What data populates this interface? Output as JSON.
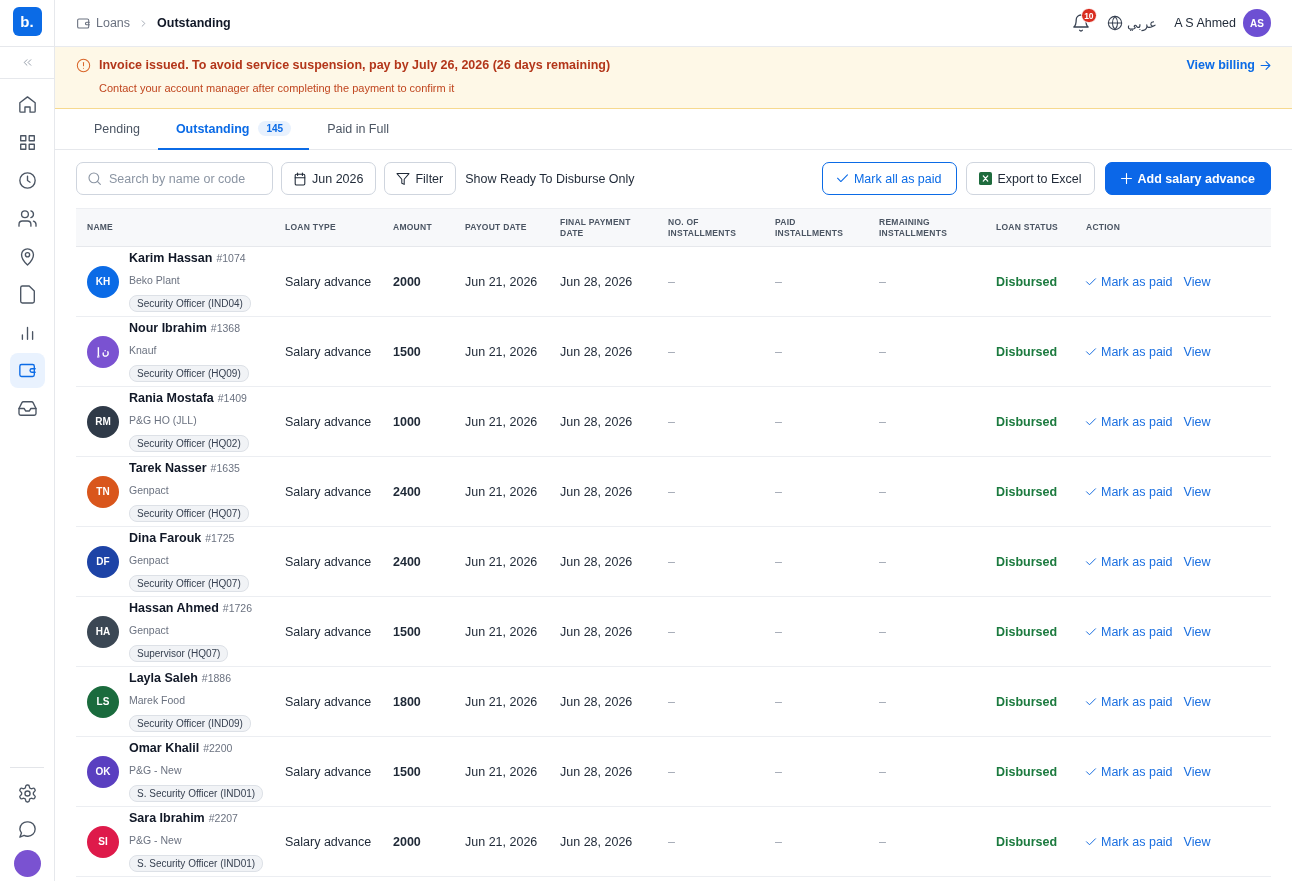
{
  "sidebar": {
    "logo": "b.",
    "items": [
      {
        "kind": "home",
        "selected": false
      },
      {
        "kind": "apps",
        "selected": false
      },
      {
        "kind": "history",
        "selected": false
      },
      {
        "kind": "people",
        "selected": false
      },
      {
        "kind": "location",
        "selected": false
      },
      {
        "kind": "documents",
        "selected": false
      },
      {
        "kind": "reports",
        "selected": false
      },
      {
        "kind": "wallet",
        "selected": true
      },
      {
        "kind": "inbox",
        "selected": false
      }
    ],
    "bottom_items": [
      {
        "kind": "settings",
        "selected": false
      },
      {
        "kind": "chat",
        "selected": false
      }
    ]
  },
  "header": {
    "breadcrumb": [
      {
        "label": "Loans",
        "current": false
      },
      {
        "label": "Outstanding",
        "current": true
      }
    ],
    "notification_count": "10",
    "language": "عربي",
    "user": {
      "name": "A S Ahmed",
      "initials": "AS"
    }
  },
  "banner": {
    "title": "Invoice issued. To avoid service suspension, pay by July 26, 2026 (26 days remaining)",
    "message": "Contact your account manager after completing the payment to confirm it",
    "link": "View billing"
  },
  "tabs": [
    {
      "label": "Pending",
      "selected": false
    },
    {
      "label": "Outstanding",
      "selected": true,
      "count": "145"
    },
    {
      "label": "Paid in Full",
      "selected": false
    }
  ],
  "toolbar": {
    "search": {
      "placeholder": "Search by name or code"
    },
    "month": "Jun 2026",
    "filter": "Filter",
    "ready_only_label": "Show Ready To Disburse Only",
    "mark_all": "Mark all as paid",
    "export": "Export to Excel",
    "add": "Add salary advance"
  },
  "table": {
    "columns": [
      "NAME",
      "LOAN TYPE",
      "AMOUNT",
      "PAYOUT DATE",
      "FINAL PAYMENT DATE",
      "NO. OF INSTALLMENTS",
      "PAID INSTALLMENTS",
      "REMAINING INSTALLMENTS",
      "LOAN STATUS",
      "ACTION"
    ],
    "rows": [
      {
        "initials": "KH",
        "color": "#0b6be6",
        "name": "Karim Hassan",
        "code": "#1074",
        "company": "Beko Plant",
        "position": "Security Officer (IND04)",
        "loan_type": "Salary advance",
        "amount": "2000",
        "payout_date": "Jun 21, 2026",
        "final_payment_date": "Jun 28, 2026",
        "installments": "–",
        "paid_installments": "–",
        "remaining_installments": "–",
        "status": "Disbursed",
        "mark_paid": "Mark as paid",
        "view": "View"
      },
      {
        "initials": "ن إ",
        "color": "#7a52d1",
        "name": "Nour Ibrahim",
        "code": "#1368",
        "company": "Knauf",
        "position": "Security Officer (HQ09)",
        "loan_type": "Salary advance",
        "amount": "1500",
        "payout_date": "Jun 21, 2026",
        "final_payment_date": "Jun 28, 2026",
        "installments": "–",
        "paid_installments": "–",
        "remaining_installments": "–",
        "status": "Disbursed",
        "mark_paid": "Mark as paid",
        "view": "View"
      },
      {
        "initials": "RM",
        "color": "#2f3a48",
        "name": "Rania Mostafa",
        "code": "#1409",
        "company": "P&G HO (JLL)",
        "position": "Security Officer (HQ02)",
        "loan_type": "Salary advance",
        "amount": "1000",
        "payout_date": "Jun 21, 2026",
        "final_payment_date": "Jun 28, 2026",
        "installments": "–",
        "paid_installments": "–",
        "remaining_installments": "–",
        "status": "Disbursed",
        "mark_paid": "Mark as paid",
        "view": "View"
      },
      {
        "initials": "TN",
        "color": "#d9561c",
        "name": "Tarek Nasser",
        "code": "#1635",
        "company": "Genpact",
        "position": "Security Officer (HQ07)",
        "loan_type": "Salary advance",
        "amount": "2400",
        "payout_date": "Jun 21, 2026",
        "final_payment_date": "Jun 28, 2026",
        "installments": "–",
        "paid_installments": "–",
        "remaining_installments": "–",
        "status": "Disbursed",
        "mark_paid": "Mark as paid",
        "view": "View"
      },
      {
        "initials": "DF",
        "color": "#1d43a6",
        "name": "Dina Farouk",
        "code": "#1725",
        "company": "Genpact",
        "position": "Security Officer (HQ07)",
        "loan_type": "Salary advance",
        "amount": "2400",
        "payout_date": "Jun 21, 2026",
        "final_payment_date": "Jun 28, 2026",
        "installments": "–",
        "paid_installments": "–",
        "remaining_installments": "–",
        "status": "Disbursed",
        "mark_paid": "Mark as paid",
        "view": "View"
      },
      {
        "initials": "HA",
        "color": "#3b4754",
        "name": "Hassan Ahmed",
        "code": "#1726",
        "company": "Genpact",
        "position": "Supervisor (HQ07)",
        "loan_type": "Salary advance",
        "amount": "1500",
        "payout_date": "Jun 21, 2026",
        "final_payment_date": "Jun 28, 2026",
        "installments": "–",
        "paid_installments": "–",
        "remaining_installments": "–",
        "status": "Disbursed",
        "mark_paid": "Mark as paid",
        "view": "View"
      },
      {
        "initials": "LS",
        "color": "#1a6b3d",
        "name": "Layla Saleh",
        "code": "#1886",
        "company": "Marek Food",
        "position": "Security Officer (IND09)",
        "loan_type": "Salary advance",
        "amount": "1800",
        "payout_date": "Jun 21, 2026",
        "final_payment_date": "Jun 28, 2026",
        "installments": "–",
        "paid_installments": "–",
        "remaining_installments": "–",
        "status": "Disbursed",
        "mark_paid": "Mark as paid",
        "view": "View"
      },
      {
        "initials": "OK",
        "color": "#5a3fc0",
        "name": "Omar Khalil",
        "code": "#2200",
        "company": "P&G - New",
        "position": "S. Security Officer (IND01)",
        "loan_type": "Salary advance",
        "amount": "1500",
        "payout_date": "Jun 21, 2026",
        "final_payment_date": "Jun 28, 2026",
        "installments": "–",
        "paid_installments": "–",
        "remaining_installments": "–",
        "status": "Disbursed",
        "mark_paid": "Mark as paid",
        "view": "View"
      },
      {
        "initials": "SI",
        "color": "#de1a4a",
        "name": "Sara Ibrahim",
        "code": "#2207",
        "company": "P&G - New",
        "position": "S. Security Officer (IND01)",
        "loan_type": "Salary advance",
        "amount": "2000",
        "payout_date": "Jun 21, 2026",
        "final_payment_date": "Jun 28, 2026",
        "installments": "–",
        "paid_installments": "–",
        "remaining_installments": "–",
        "status": "Disbursed",
        "mark_paid": "Mark as paid",
        "view": "View"
      }
    ]
  }
}
